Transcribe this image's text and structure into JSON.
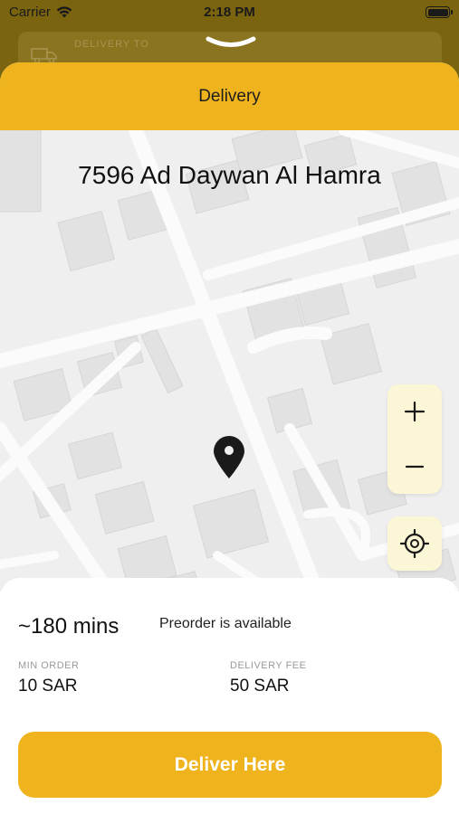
{
  "status_bar": {
    "carrier": "Carrier",
    "time": "2:18 PM"
  },
  "background": {
    "delivery_to_label": "DELIVERY TO"
  },
  "sheet": {
    "title": "Delivery",
    "address": "7596 Ad Daywan Al Hamra",
    "eta": "~180 mins",
    "preorder_text": "Preorder is available",
    "min_order_label": "MIN ORDER",
    "min_order_value": "10 SAR",
    "delivery_fee_label": "DELIVERY FEE",
    "delivery_fee_value": "50 SAR",
    "primary_button": "Deliver Here"
  },
  "colors": {
    "accent": "#efb41d",
    "control_bg": "#fbf6d6"
  },
  "icons": {
    "pin": "map-pin-icon",
    "zoom_in": "plus-icon",
    "zoom_out": "minus-icon",
    "locate": "crosshair-icon"
  }
}
